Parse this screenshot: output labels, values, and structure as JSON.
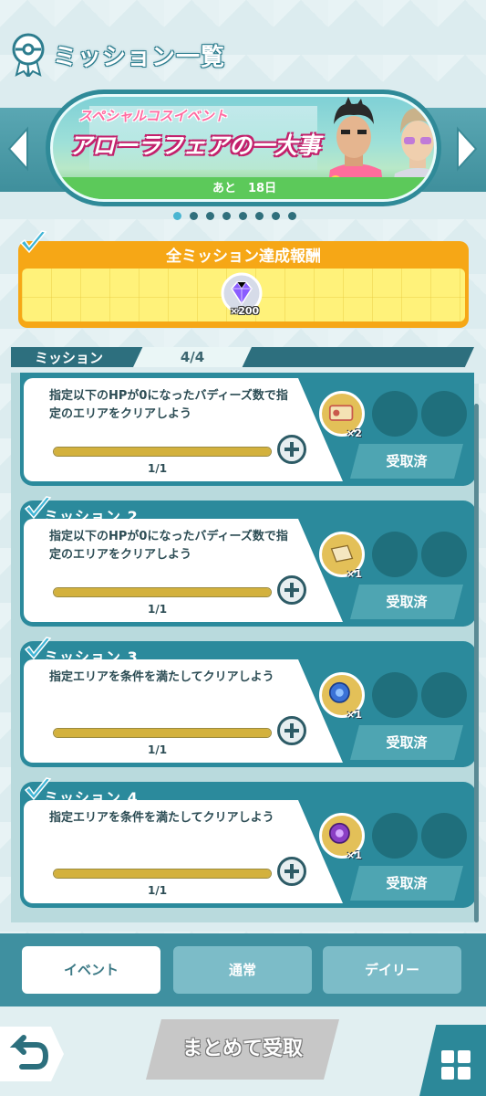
{
  "header": {
    "title": "ミッション一覧",
    "icon": "medal-icon"
  },
  "banner": {
    "subtitle": "スペシャルコスイベント",
    "title": "アローラフェアの一大事",
    "remaining": "あと　18日",
    "dots_total": 8,
    "active_dot": 0
  },
  "all_reward": {
    "title": "全ミッション達成報酬",
    "item_icon": "gem-icon",
    "count": "×200"
  },
  "mission_header": {
    "label": "ミッション",
    "progress": "4/4"
  },
  "missions": [
    {
      "title": "",
      "desc": "指定以下のHPが0になったバディーズ数で指定のエリアをクリアしよう",
      "progress": 1.0,
      "frac": "1/1",
      "item": "ticket-icon",
      "count": "×2",
      "status": "受取済"
    },
    {
      "title": "ミッション 2",
      "desc": "指定以下のHPが0になったバディーズ数で指定のエリアをクリアしよう",
      "progress": 1.0,
      "frac": "1/1",
      "item": "scroll-icon",
      "count": "×1",
      "status": "受取済"
    },
    {
      "title": "ミッション 3",
      "desc": "指定エリアを条件を満たしてクリアしよう",
      "progress": 1.0,
      "frac": "1/1",
      "item": "blue-orb-icon",
      "count": "×1",
      "status": "受取済"
    },
    {
      "title": "ミッション 4",
      "desc": "指定エリアを条件を満たしてクリアしよう",
      "progress": 1.0,
      "frac": "1/1",
      "item": "purple-orb-icon",
      "count": "×1",
      "status": "受取済"
    }
  ],
  "tabs": [
    {
      "label": "イベント",
      "active": true
    },
    {
      "label": "通常",
      "active": false
    },
    {
      "label": "デイリー",
      "active": false
    }
  ],
  "bottom": {
    "collect_label": "まとめて受取",
    "back_icon": "back-arrow-icon",
    "menu_icon": "grid-icon"
  },
  "colors": {
    "teal": "#2b8a9c",
    "gold": "#f6a716",
    "claimed": "#4ea5b2"
  }
}
